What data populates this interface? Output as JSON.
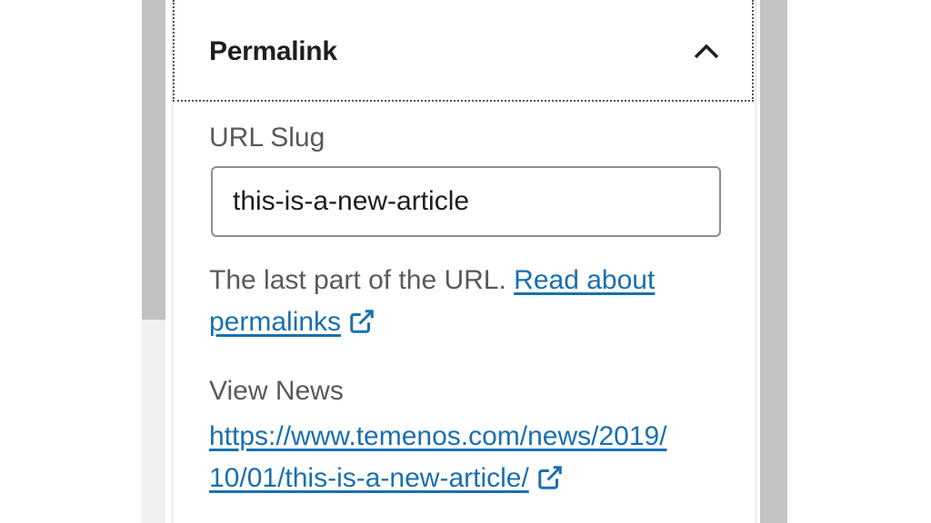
{
  "permalink": {
    "title": "Permalink",
    "collapse_icon": "chevron-up-icon",
    "url_slug_label": "URL Slug",
    "url_slug_value": "this-is-a-new-article",
    "help_text": "The last part of the URL.",
    "help_link_line1": "Read about",
    "help_link_line2": "permalinks",
    "view_label": "View News",
    "view_link_line1": "https://www.temenos.com/news/2019/",
    "view_link_line2": "10/01/this-is-a-new-article/",
    "external_icon": "external-link-icon"
  },
  "colors": {
    "link": "#1a6fb0",
    "text": "#1e1e1e",
    "muted_text": "#5a5a5a",
    "border": "#8f8f8f"
  }
}
